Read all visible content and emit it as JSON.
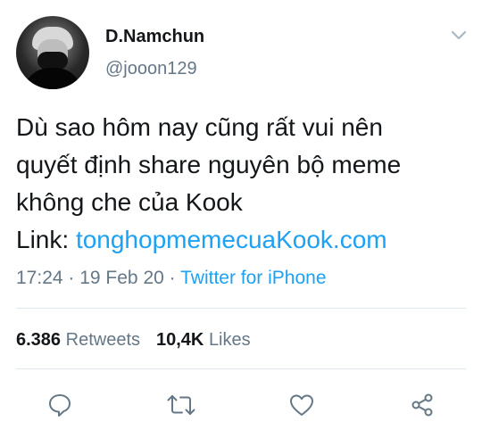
{
  "author": {
    "display_name": "D.Namchun",
    "handle": "@jooon129"
  },
  "tweet": {
    "lines": [
      "Dù sao hôm nay cũng rất vui nên",
      "quyết định share nguyên bộ meme",
      "không che của Kook"
    ],
    "link_prefix": "Link: ",
    "link_text": "tonghopmemecuaKook.com"
  },
  "meta": {
    "time": "17:24",
    "separator": " · ",
    "date": "19 Feb 20",
    "source": "Twitter for iPhone"
  },
  "stats": {
    "retweets_count": "6.386",
    "retweets_label": "Retweets",
    "likes_count": "10,4K",
    "likes_label": "Likes"
  },
  "actions": {
    "reply": "reply-icon",
    "retweet": "retweet-icon",
    "like": "heart-icon",
    "share": "share-icon"
  },
  "colors": {
    "link": "#1da1f2",
    "secondary_text": "#657786",
    "primary_text": "#14171a",
    "divider": "#e1e8ed"
  }
}
